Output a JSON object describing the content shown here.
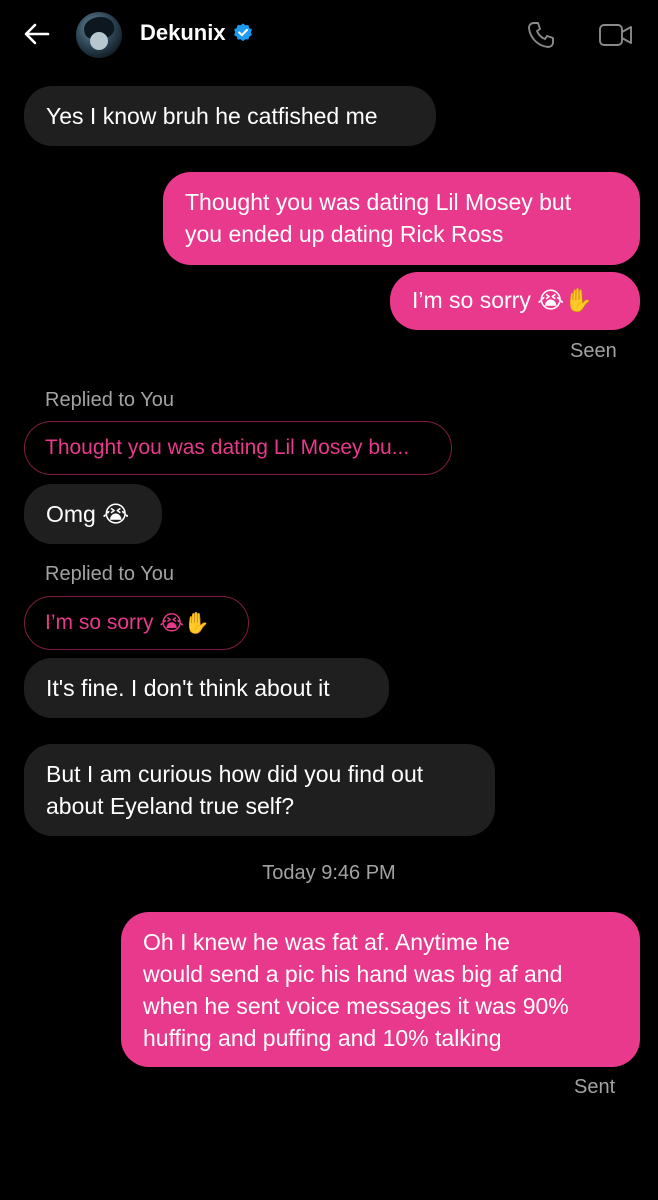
{
  "header": {
    "name": "Dekunix",
    "icons": [
      "back-arrow-icon",
      "avatar",
      "verified-badge-icon",
      "phone-icon",
      "video-camera-icon"
    ],
    "accent_color": "#e8398c",
    "verified_color": "#1d9bf0"
  },
  "messages": {
    "m1": "Yes I know bruh he catfished me",
    "m2_line1": "Thought you was dating Lil Mosey but",
    "m2_line2": "you ended up dating Rick Ross",
    "m3_text": "I’m so sorry",
    "m3_emoji": "😭✋",
    "seen": "Seen",
    "reply1_label": "Replied to You",
    "reply1_quote": "Thought you was dating Lil Mosey bu...",
    "m4_text": "Omg",
    "m4_emoji": "😭",
    "reply2_label": "Replied to You",
    "reply2_quote_text": "I’m so sorry",
    "reply2_quote_emoji": "😭✋",
    "m5": "It's fine. I don't think about it",
    "m6_line1": "But I am curious how did you find out",
    "m6_line2": "about Eyeland true self?",
    "timestamp": "Today 9:46 PM",
    "m7_line1": "Oh I knew he was fat af. Anytime he",
    "m7_line2": "would send a pic his hand was big af and",
    "m7_line3": "when he sent voice messages it was 90%",
    "m7_line4": "huffing and puffing and 10% talking",
    "sent": "Sent"
  }
}
